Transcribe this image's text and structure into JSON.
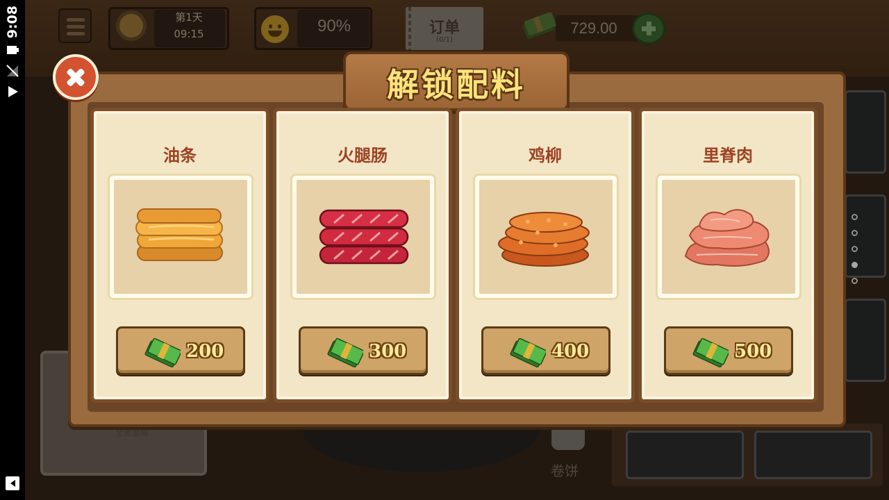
{
  "status_bar": {
    "time": "9:08"
  },
  "hud": {
    "day": "第1天",
    "clock": "09:15",
    "satisfaction": "90%",
    "order_title": "订单",
    "order_count": "(0/1)",
    "money": "729.00"
  },
  "background": {
    "station_label": "卷饼",
    "plate_label": "全麦面糊"
  },
  "modal": {
    "title": "解锁配料",
    "items": [
      {
        "name": "油条",
        "price": "200",
        "icon": "youtiao-icon"
      },
      {
        "name": "火腿肠",
        "price": "300",
        "icon": "sausage-icon"
      },
      {
        "name": "鸡柳",
        "price": "400",
        "icon": "chicken-strips-icon"
      },
      {
        "name": "里脊肉",
        "price": "500",
        "icon": "tenderloin-icon"
      }
    ]
  },
  "page_indicator": {
    "pages": 5,
    "active": 4
  }
}
